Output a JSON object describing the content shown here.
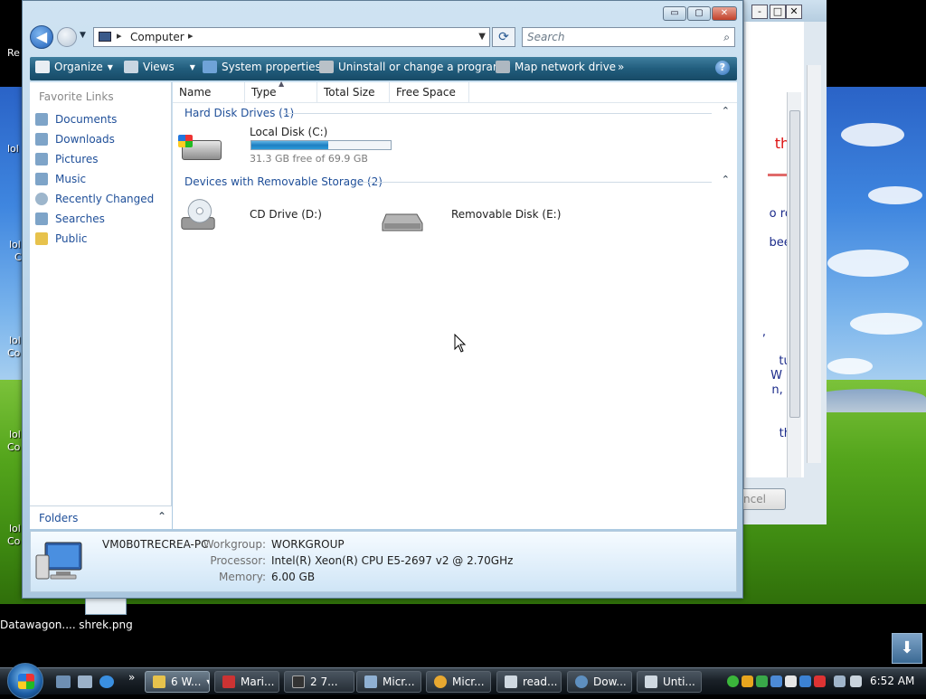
{
  "desktop": {
    "top_left_label": "Re",
    "side_labels": [
      "lol",
      "lol",
      "lol",
      "lol",
      "lol"
    ],
    "side_sub": [
      "C",
      "Co",
      "Co",
      "Co"
    ],
    "icons": [
      {
        "label": "Datawagon...."
      },
      {
        "label": "shrek.png"
      }
    ]
  },
  "background_window": {
    "caption_buttons": [
      "-",
      "□",
      "✕"
    ],
    "lines": [
      "the",
      "o roll",
      "been",
      ",",
      "tup",
      "W",
      "n, at",
      "the"
    ],
    "cancel_label": "ncel"
  },
  "window": {
    "caption_buttons": {
      "minimize": "▭",
      "maximize": "▢",
      "close": "✕"
    },
    "address": {
      "segments": [
        "Computer"
      ]
    },
    "search": {
      "placeholder": "Search"
    },
    "toolbar": [
      {
        "label": "Organize",
        "icon": "organize-icon",
        "dropdown": true
      },
      {
        "label": "Views",
        "icon": "views-icon",
        "dropdown": true
      },
      {
        "label": "System properties",
        "icon": "system-properties-icon",
        "dropdown": false
      },
      {
        "label": "Uninstall or change a program",
        "icon": "uninstall-icon",
        "dropdown": false
      },
      {
        "label": "Map network drive",
        "icon": "map-drive-icon",
        "dropdown": false
      }
    ],
    "toolbar_more": "»",
    "help_label": "?",
    "nav_pane": {
      "title": "Favorite Links",
      "links": [
        {
          "label": "Documents",
          "icon": "documents-icon"
        },
        {
          "label": "Downloads",
          "icon": "downloads-icon"
        },
        {
          "label": "Pictures",
          "icon": "pictures-icon"
        },
        {
          "label": "Music",
          "icon": "music-icon"
        },
        {
          "label": "Recently Changed",
          "icon": "recently-changed-icon"
        },
        {
          "label": "Searches",
          "icon": "searches-icon"
        },
        {
          "label": "Public",
          "icon": "public-folder-icon"
        }
      ],
      "folders_label": "Folders"
    },
    "columns": [
      "Name",
      "Type",
      "Total Size",
      "Free Space"
    ],
    "groups": [
      {
        "label": "Hard Disk Drives (1)",
        "items": [
          {
            "name": "Local Disk (C:)",
            "free_text": "31.3 GB free of 69.9 GB",
            "used_fraction": 0.552
          }
        ]
      },
      {
        "label": "Devices with Removable Storage (2)",
        "items": [
          {
            "name": "CD Drive (D:)"
          },
          {
            "name": "Removable Disk (E:)"
          }
        ]
      }
    ],
    "details": {
      "computer_name": "VM0B0TRECREA-PC",
      "workgroup_label": "Workgroup:",
      "workgroup": "WORKGROUP",
      "processor_label": "Processor:",
      "processor": "Intel(R) Xeon(R) CPU E5-2697 v2 @ 2.70GHz",
      "memory_label": "Memory:",
      "memory": "6.00 GB"
    }
  },
  "taskbar": {
    "more": "»",
    "tasks": [
      {
        "label": "6 W...",
        "active": true
      },
      {
        "label": "Mari..."
      },
      {
        "label": "2 7..."
      },
      {
        "label": "Micr..."
      },
      {
        "label": "Micr..."
      },
      {
        "label": "read..."
      },
      {
        "label": "Dow..."
      },
      {
        "label": "Unti..."
      }
    ],
    "clock": "6:52 AM"
  },
  "colors": {
    "toolbar": "#215d7d",
    "link": "#1f4f99",
    "progress": "#1f7fc2"
  }
}
